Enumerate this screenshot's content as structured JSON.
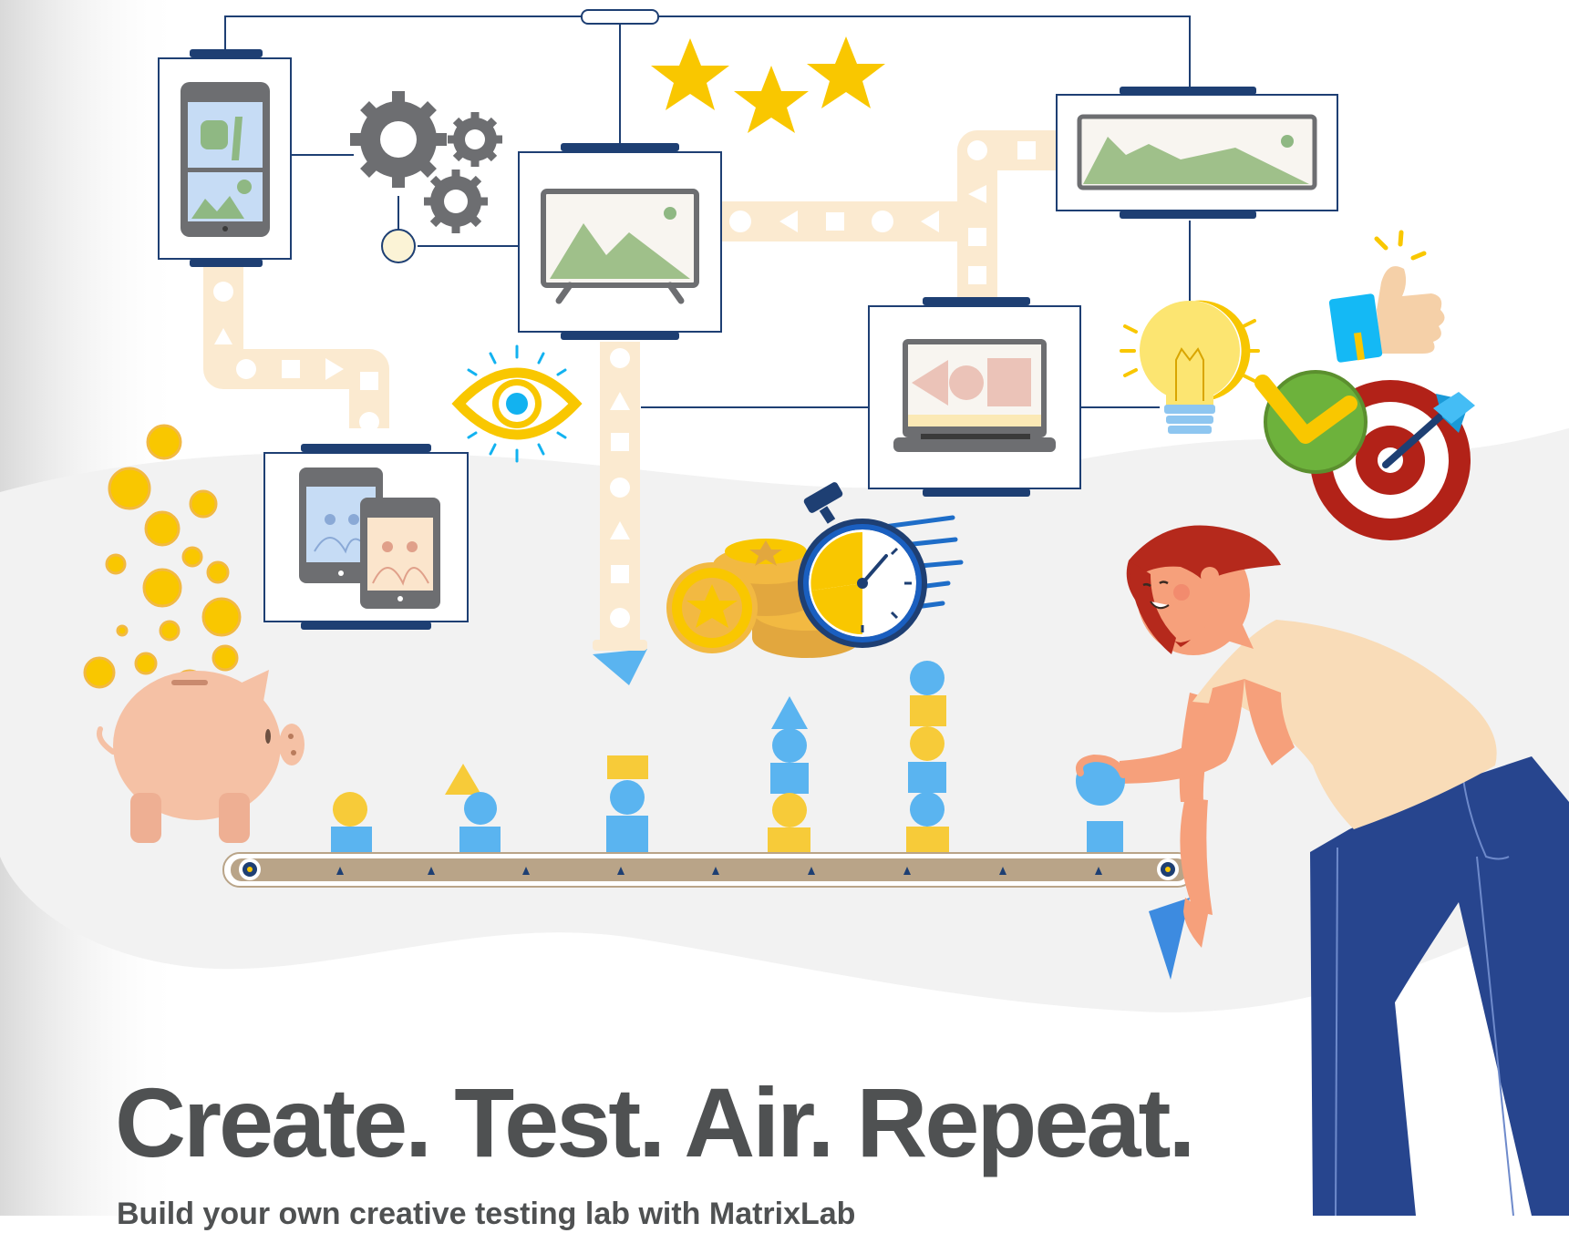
{
  "headline": "Create. Test. Air. Repeat.",
  "subheadline": "Build your own creative testing lab with MatrixLab",
  "colors": {
    "text": "#4f5152",
    "navy": "#1e3f73",
    "yellow": "#f9c700",
    "blue": "#5ab4f0",
    "conveyor": "#b9a488",
    "path": "#fbead0",
    "hair": "#b5291c",
    "pants": "#27458e",
    "shirt": "#f9dcb8",
    "target": "#b22218",
    "pig": "#f5c1a5"
  },
  "icons": [
    "phone-screen-icon",
    "gears-icon",
    "tv-screen-icon",
    "stars-icon",
    "wide-screen-icon",
    "tablets-screen-icon",
    "eye-icon",
    "laptop-screen-icon",
    "lightbulb-icon",
    "thumbs-up-icon",
    "checkmark-icon",
    "target-icon",
    "coins-icon",
    "stopwatch-icon",
    "piggy-bank-icon",
    "conveyor-belt-icon",
    "woman-figure-icon"
  ]
}
